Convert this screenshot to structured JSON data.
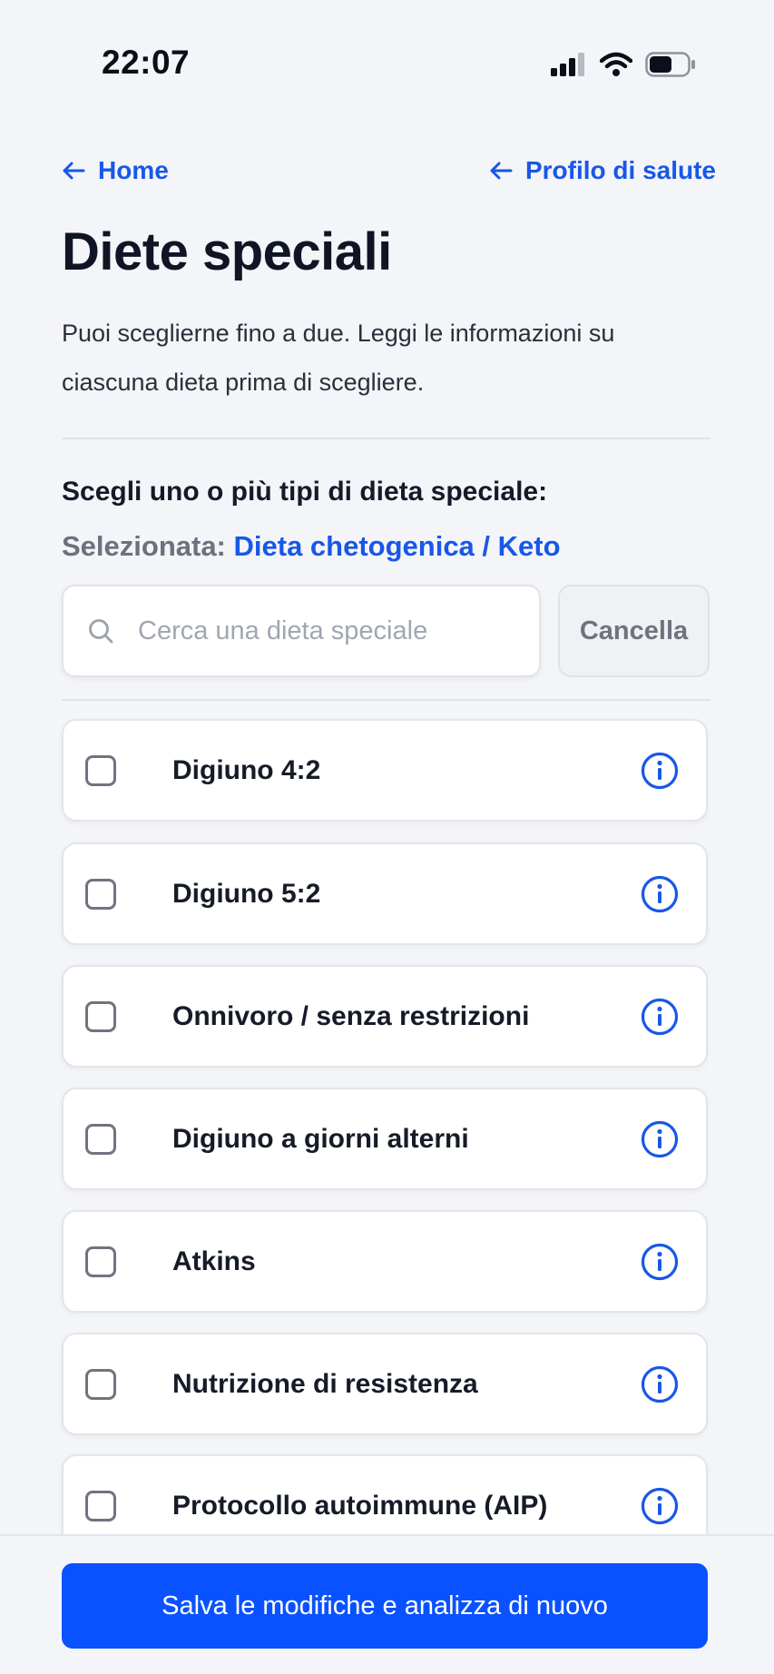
{
  "status_bar": {
    "time": "22:07",
    "icons": [
      "cellular-signal-icon",
      "wifi-icon",
      "battery-icon"
    ]
  },
  "nav": {
    "back_home": "Home",
    "back_profile": "Profilo di salute"
  },
  "header": {
    "title": "Diete speciali",
    "intro": "Puoi sceglierne fino a due. Leggi le informazioni su ciascuna dieta prima di scegliere."
  },
  "selection": {
    "prompt": "Scegli uno o più tipi di dieta speciale:",
    "selected_label": "Selezionata: ",
    "selected_value": "Dieta chetogenica / Keto"
  },
  "search": {
    "placeholder": "Cerca una dieta speciale",
    "value": "",
    "cancel_label": "Cancella"
  },
  "diets": [
    {
      "label": "Digiuno 4:2",
      "checked": false
    },
    {
      "label": "Digiuno 5:2",
      "checked": false
    },
    {
      "label": "Onnivoro / senza restrizioni",
      "checked": false
    },
    {
      "label": "Digiuno a giorni alterni",
      "checked": false
    },
    {
      "label": "Atkins",
      "checked": false
    },
    {
      "label": "Nutrizione di resistenza",
      "checked": false
    },
    {
      "label": "Protocollo autoimmune (AIP)",
      "checked": false
    }
  ],
  "footer": {
    "save_label": "Salva le modifiche e analizza di nuovo"
  },
  "colors": {
    "accent": "#1857e8",
    "primary_button": "#0a52ff",
    "background": "#f4f5f8"
  }
}
